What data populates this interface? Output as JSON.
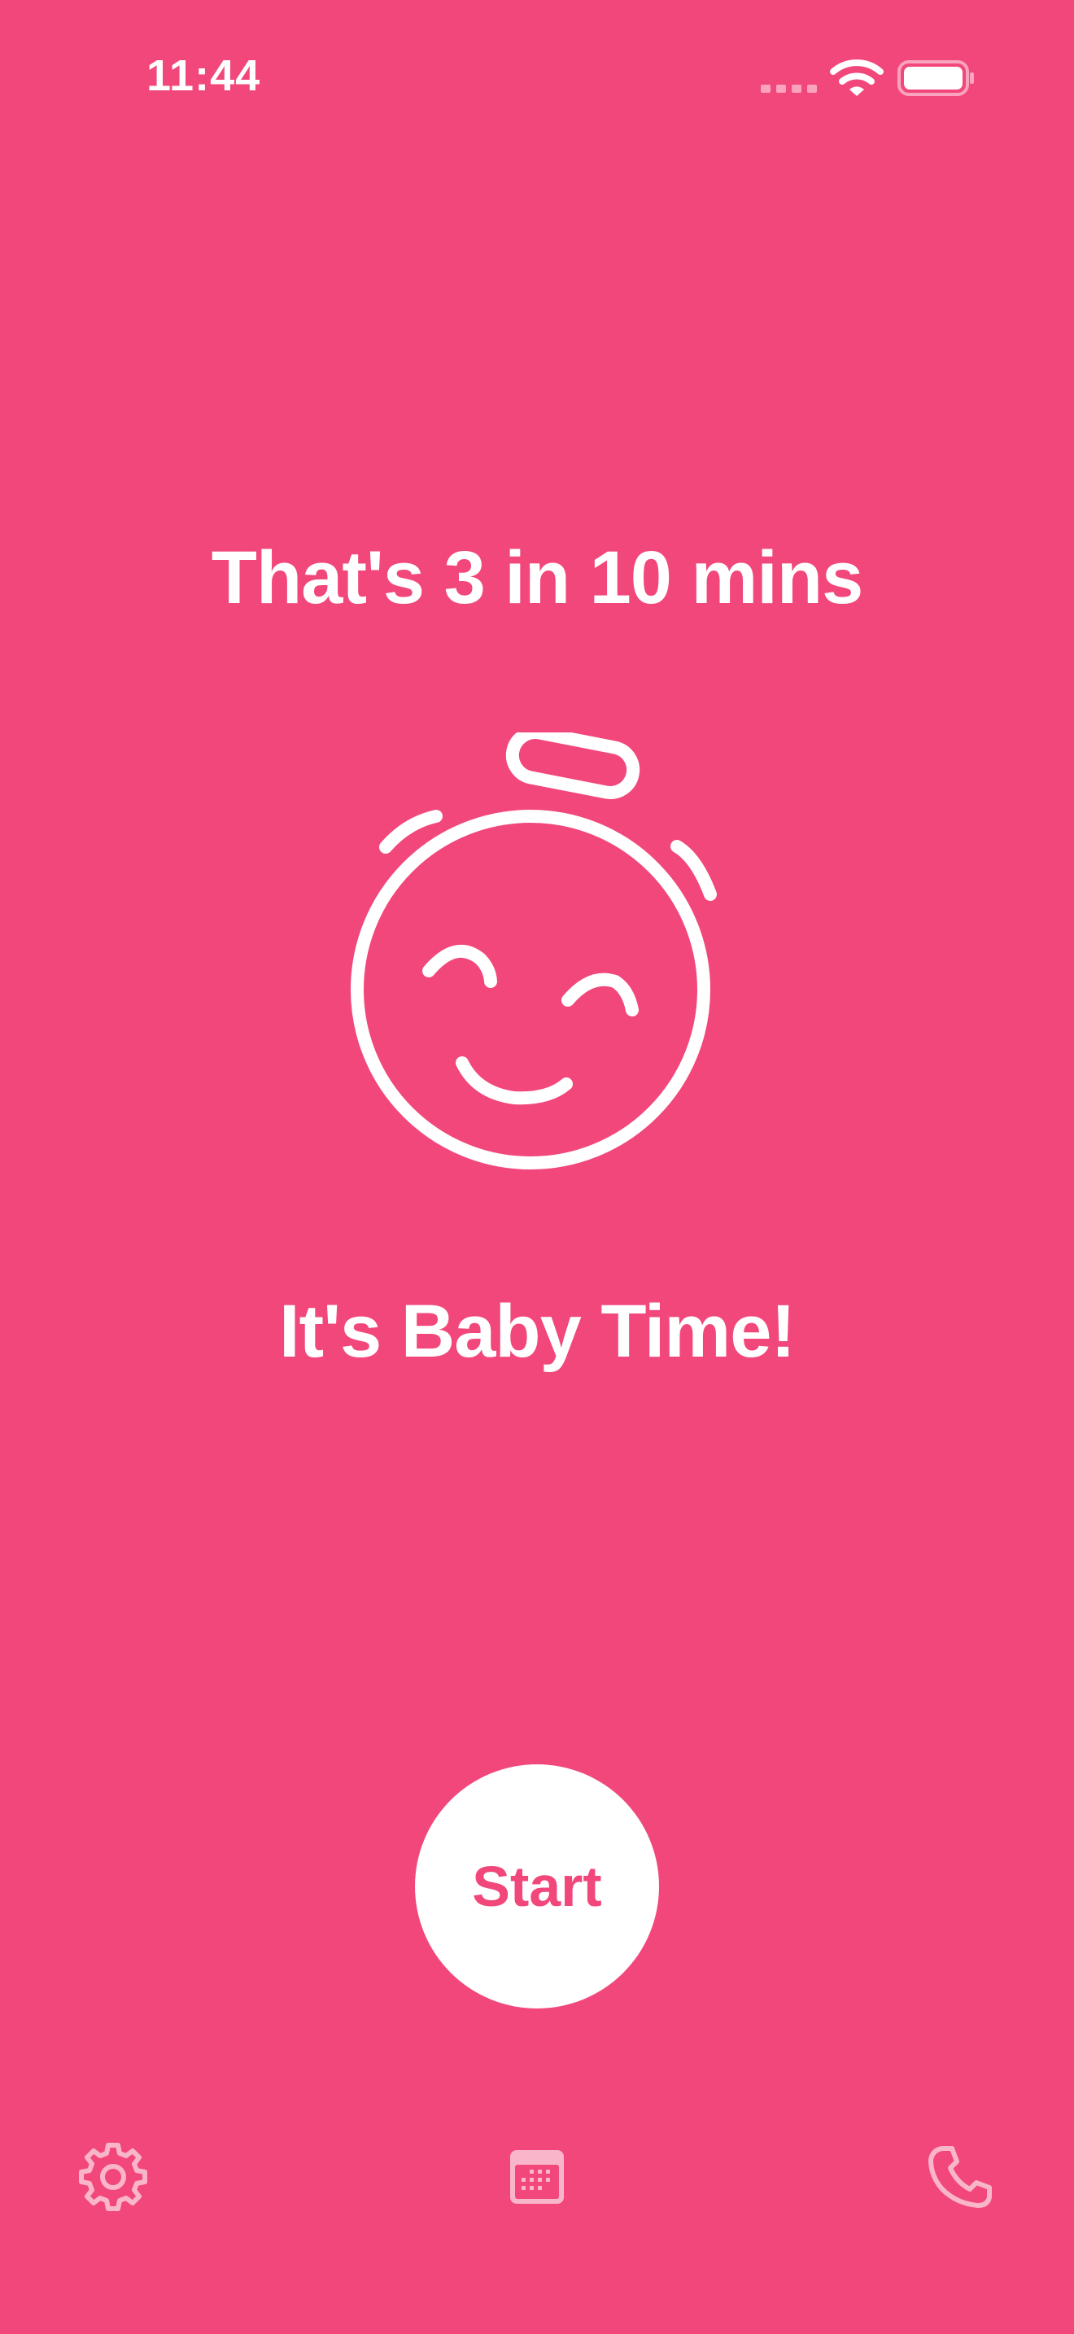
{
  "status_bar": {
    "time": "11:44",
    "icons": [
      "cellular-signal-icon",
      "wifi-icon",
      "battery-icon"
    ]
  },
  "main": {
    "headline": "That's 3 in 10 mins",
    "illustration": "baby-face-stopwatch-icon",
    "subheadline": "It's Baby Time!",
    "start_label": "Start"
  },
  "tab_bar": {
    "items": [
      {
        "icon": "gear-icon",
        "name": "settings"
      },
      {
        "icon": "calendar-icon",
        "name": "calendar"
      },
      {
        "icon": "phone-icon",
        "name": "call"
      }
    ]
  },
  "colors": {
    "background": "#F2477B",
    "foreground": "#FFFFFF",
    "tab_icon": "#F9B6CB"
  }
}
